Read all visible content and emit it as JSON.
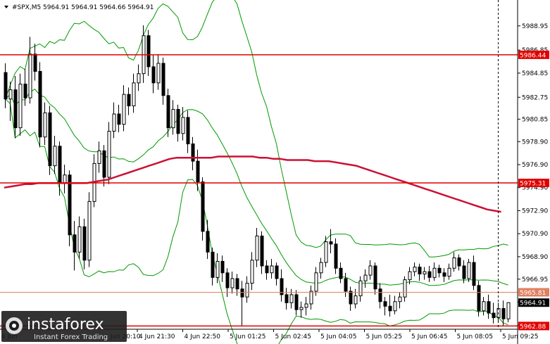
{
  "chart_data": {
    "type": "candlestick",
    "title": "#SPX,M5  5964.91 5964.91 5964.66 5964.91",
    "ylim": [
      5962.6,
      5991.2
    ],
    "y_ticks": [
      "5988.95",
      "5986.85",
      "5984.85",
      "5982.75",
      "5980.85",
      "5978.90",
      "5976.90",
      "5974.90",
      "5972.90",
      "5970.90",
      "5968.90",
      "5966.95",
      "5964.95",
      "5962.95"
    ],
    "x_ticks": [
      "4 Jun 21:30",
      "4 Jun 22:50",
      "5 Jun 01:25",
      "5 Jun 02:45",
      "5 Jun 04:05",
      "5 Jun 05:25",
      "5 Jun 06:45",
      "5 Jun 08:05",
      "5 Jun 09:25"
    ],
    "x_tick_partial": "4 Jun 20:10",
    "x_tick_partial_first": "4 Jun",
    "horizontal_lines": [
      {
        "value": 5986.44,
        "label": "5986.44",
        "color": "#e00000"
      },
      {
        "value": 5975.31,
        "label": "5975.31",
        "color": "#e00000"
      },
      {
        "value": 5965.81,
        "label": "5965.81",
        "color": "#e08060"
      },
      {
        "value": 5962.88,
        "label": "5962.88",
        "color": "#e00000"
      }
    ],
    "current_price": {
      "value": 5964.91,
      "label": "5964.91"
    },
    "cursor_index": 100,
    "candles": [
      [
        5984.9,
        5985.7,
        5981.8,
        5982.6
      ],
      [
        5982.6,
        5984.1,
        5980.7,
        5983.4
      ],
      [
        5983.4,
        5984.6,
        5979.2,
        5980.1
      ],
      [
        5980.1,
        5984.8,
        5979.4,
        5983.9
      ],
      [
        5983.9,
        5985.2,
        5982.0,
        5982.7
      ],
      [
        5982.7,
        5988.0,
        5982.2,
        5986.5
      ],
      [
        5986.5,
        5987.4,
        5984.2,
        5985.0
      ],
      [
        5985.0,
        5985.8,
        5978.4,
        5979.3
      ],
      [
        5979.3,
        5982.3,
        5978.6,
        5981.4
      ],
      [
        5981.4,
        5982.0,
        5976.0,
        5976.8
      ],
      [
        5976.8,
        5979.4,
        5976.1,
        5978.5
      ],
      [
        5978.5,
        5978.9,
        5974.2,
        5975.3
      ],
      [
        5975.3,
        5976.9,
        5974.4,
        5976.0
      ],
      [
        5976.0,
        5976.4,
        5969.8,
        5970.8
      ],
      [
        5970.8,
        5972.0,
        5967.7,
        5969.3
      ],
      [
        5969.3,
        5972.4,
        5968.7,
        5971.5
      ],
      [
        5971.5,
        5972.2,
        5967.8,
        5968.6
      ],
      [
        5968.6,
        5974.5,
        5968.0,
        5973.7
      ],
      [
        5973.7,
        5977.8,
        5973.2,
        5977.0
      ],
      [
        5977.0,
        5978.9,
        5976.2,
        5978.1
      ],
      [
        5978.1,
        5978.6,
        5975.0,
        5975.8
      ],
      [
        5975.8,
        5980.6,
        5975.2,
        5979.8
      ],
      [
        5979.8,
        5982.3,
        5979.2,
        5981.3
      ],
      [
        5981.3,
        5982.1,
        5979.7,
        5980.4
      ],
      [
        5980.4,
        5983.8,
        5979.8,
        5983.0
      ],
      [
        5983.0,
        5983.6,
        5981.2,
        5982.0
      ],
      [
        5982.0,
        5984.8,
        5981.4,
        5984.0
      ],
      [
        5984.0,
        5985.6,
        5983.3,
        5984.8
      ],
      [
        5984.8,
        5989.0,
        5984.0,
        5988.1
      ],
      [
        5988.1,
        5988.6,
        5984.6,
        5985.4
      ],
      [
        5985.4,
        5986.4,
        5983.1,
        5984.0
      ],
      [
        5984.0,
        5986.5,
        5983.4,
        5985.7
      ],
      [
        5985.7,
        5986.2,
        5982.1,
        5982.9
      ],
      [
        5982.9,
        5983.5,
        5979.3,
        5980.1
      ],
      [
        5980.1,
        5982.5,
        5979.5,
        5981.7
      ],
      [
        5981.7,
        5982.1,
        5978.9,
        5979.6
      ],
      [
        5979.6,
        5981.9,
        5979.0,
        5981.0
      ],
      [
        5981.0,
        5981.6,
        5977.9,
        5978.7
      ],
      [
        5978.7,
        5979.3,
        5976.4,
        5977.2
      ],
      [
        5977.2,
        5978.2,
        5974.6,
        5975.4
      ],
      [
        5975.4,
        5975.8,
        5970.3,
        5971.1
      ],
      [
        5971.1,
        5972.1,
        5968.7,
        5969.3
      ],
      [
        5969.3,
        5969.7,
        5966.4,
        5967.1
      ],
      [
        5967.1,
        5969.2,
        5966.6,
        5968.5
      ],
      [
        5968.5,
        5969.0,
        5966.7,
        5967.5
      ],
      [
        5967.5,
        5967.9,
        5965.4,
        5966.2
      ],
      [
        5966.2,
        5967.6,
        5965.7,
        5967.0
      ],
      [
        5967.0,
        5967.4,
        5965.5,
        5966.1
      ],
      [
        5966.1,
        5966.8,
        5962.9,
        5965.4
      ],
      [
        5965.4,
        5967.2,
        5964.9,
        5966.6
      ],
      [
        5966.6,
        5969.3,
        5966.0,
        5968.6
      ],
      [
        5968.6,
        5971.4,
        5968.0,
        5970.7
      ],
      [
        5970.7,
        5971.1,
        5967.4,
        5968.1
      ],
      [
        5968.1,
        5968.6,
        5966.9,
        5967.5
      ],
      [
        5967.5,
        5968.7,
        5967.0,
        5968.1
      ],
      [
        5968.1,
        5968.4,
        5966.4,
        5967.0
      ],
      [
        5967.0,
        5967.8,
        5965.0,
        5965.6
      ],
      [
        5965.6,
        5966.2,
        5964.3,
        5964.9
      ],
      [
        5964.9,
        5966.1,
        5964.4,
        5965.6
      ],
      [
        5965.6,
        5966.0,
        5963.8,
        5964.3
      ],
      [
        5964.3,
        5965.0,
        5963.6,
        5964.5
      ],
      [
        5964.5,
        5965.4,
        5963.8,
        5964.8
      ],
      [
        5964.8,
        5966.4,
        5964.3,
        5965.9
      ],
      [
        5965.9,
        5968.0,
        5965.5,
        5967.5
      ],
      [
        5967.5,
        5968.8,
        5967.0,
        5968.4
      ],
      [
        5968.4,
        5970.7,
        5968.0,
        5970.2
      ],
      [
        5970.2,
        5971.3,
        5969.2,
        5970.0
      ],
      [
        5970.0,
        5970.5,
        5967.4,
        5967.9
      ],
      [
        5967.9,
        5968.4,
        5966.6,
        5967.0
      ],
      [
        5967.0,
        5967.5,
        5965.4,
        5965.9
      ],
      [
        5965.9,
        5966.3,
        5964.2,
        5964.8
      ],
      [
        5964.8,
        5966.1,
        5964.4,
        5965.5
      ],
      [
        5965.5,
        5967.2,
        5965.0,
        5966.8
      ],
      [
        5966.8,
        5967.8,
        5966.2,
        5967.3
      ],
      [
        5967.3,
        5968.6,
        5966.9,
        5968.1
      ],
      [
        5968.1,
        5968.4,
        5965.6,
        5966.1
      ],
      [
        5966.1,
        5966.6,
        5964.4,
        5965.0
      ],
      [
        5965.0,
        5965.4,
        5963.8,
        5964.6
      ],
      [
        5964.6,
        5965.6,
        5963.7,
        5964.2
      ],
      [
        5964.2,
        5965.5,
        5963.9,
        5965.0
      ],
      [
        5965.0,
        5965.8,
        5964.4,
        5965.4
      ],
      [
        5965.4,
        5967.2,
        5965.0,
        5966.9
      ],
      [
        5966.9,
        5968.0,
        5966.5,
        5967.6
      ],
      [
        5967.6,
        5968.4,
        5967.2,
        5968.0
      ],
      [
        5968.0,
        5968.3,
        5966.8,
        5967.4
      ],
      [
        5967.4,
        5968.0,
        5966.9,
        5967.6
      ],
      [
        5967.6,
        5968.1,
        5966.7,
        5967.1
      ],
      [
        5967.1,
        5968.4,
        5966.8,
        5967.9
      ],
      [
        5967.9,
        5968.2,
        5967.1,
        5967.5
      ],
      [
        5967.5,
        5967.9,
        5966.7,
        5967.2
      ],
      [
        5967.2,
        5968.3,
        5966.9,
        5967.9
      ],
      [
        5967.9,
        5969.3,
        5967.6,
        5968.8
      ],
      [
        5968.8,
        5969.1,
        5967.7,
        5968.1
      ],
      [
        5968.1,
        5968.6,
        5966.6,
        5967.0
      ],
      [
        5967.0,
        5968.7,
        5966.7,
        5968.4
      ],
      [
        5968.4,
        5969.0,
        5966.0,
        5966.4
      ],
      [
        5966.4,
        5966.8,
        5963.7,
        5964.2
      ],
      [
        5964.2,
        5965.4,
        5963.8,
        5965.0
      ],
      [
        5965.0,
        5965.6,
        5963.5,
        5964.0
      ],
      [
        5964.0,
        5964.9,
        5963.1,
        5963.6
      ],
      [
        5963.6,
        5964.9,
        5963.2,
        5964.4
      ],
      [
        5964.4,
        5965.1,
        5962.9,
        5963.5
      ],
      [
        5963.5,
        5964.9,
        5963.2,
        5964.91
      ]
    ],
    "ma": [
      5974.9,
      5975.0,
      5975.1,
      5975.2,
      5975.2,
      5975.3,
      5975.3,
      5975.3,
      5975.3,
      5975.3,
      5975.3,
      5975.3,
      5975.3,
      5975.4,
      5975.5,
      5975.6,
      5975.8,
      5976.0,
      5976.2,
      5976.4,
      5976.6,
      5976.8,
      5977.0,
      5977.2,
      5977.4,
      5977.5,
      5977.5,
      5977.5,
      5977.5,
      5977.5,
      5977.5,
      5977.6,
      5977.6,
      5977.6,
      5977.6,
      5977.6,
      5977.6,
      5977.5,
      5977.5,
      5977.4,
      5977.4,
      5977.3,
      5977.3,
      5977.3,
      5977.3,
      5977.2,
      5977.2,
      5977.2,
      5977.1,
      5977.0,
      5976.9,
      5976.8,
      5976.6,
      5976.4,
      5976.2,
      5976.0,
      5975.8,
      5975.6,
      5975.4,
      5975.2,
      5975.0,
      5974.8,
      5974.6,
      5974.4,
      5974.2,
      5974.0,
      5973.8,
      5973.6,
      5973.4,
      5973.2,
      5973.0,
      5972.9,
      5972.8
    ],
    "ma_start_index": 0,
    "ma_step": 1.4,
    "bb_period": 20,
    "bb_mult": 2,
    "colors": {
      "background": "#ffffff",
      "candle": "#000000",
      "bands": "#009900",
      "ma": "#cc1133",
      "lines": "#e00000"
    }
  },
  "watermark": {
    "brand": "instaforex",
    "tagline": "Instant Forex Trading"
  }
}
